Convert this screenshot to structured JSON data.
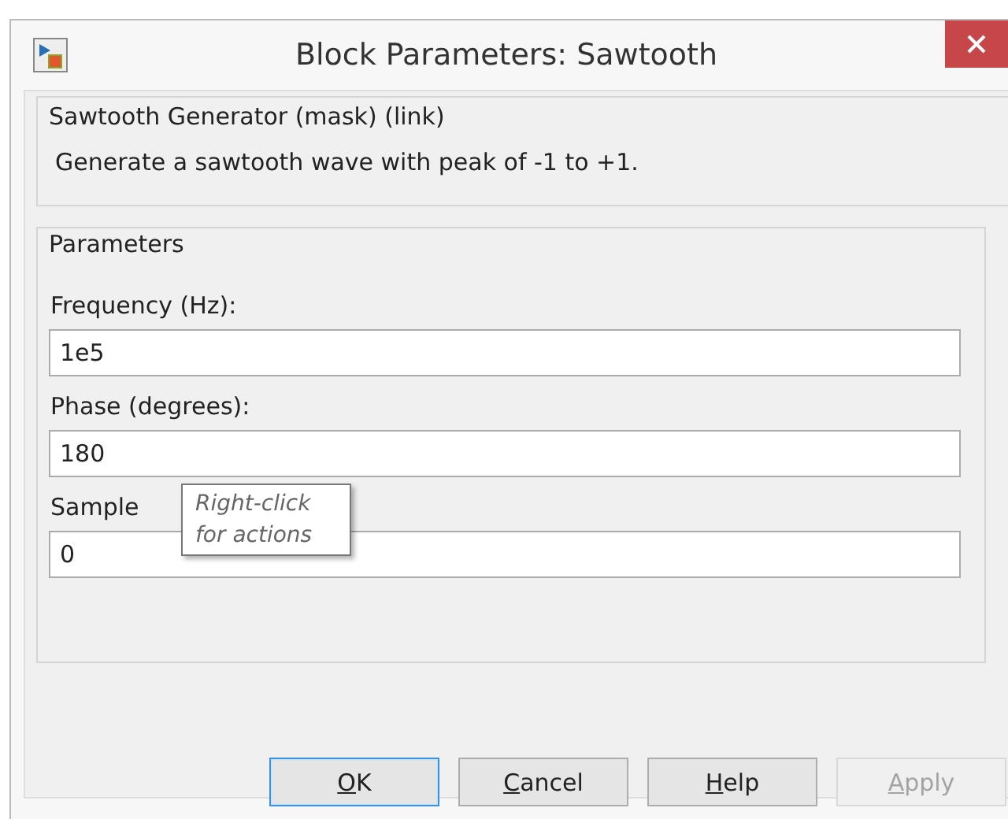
{
  "window": {
    "title": "Block Parameters: Sawtooth"
  },
  "description_group": {
    "title": "Sawtooth Generator (mask) (link)",
    "text": "Generate a sawtooth wave with peak of -1 to +1."
  },
  "parameters_group": {
    "title": "Parameters",
    "fields": [
      {
        "label": "Frequency (Hz):",
        "value": "1e5"
      },
      {
        "label": "Phase (degrees):",
        "value": "180"
      },
      {
        "label": "Sample",
        "value": "0"
      }
    ]
  },
  "tooltip": {
    "text": "Right-click for actions"
  },
  "buttons": [
    {
      "label": "OK",
      "focused": true,
      "disabled": false
    },
    {
      "label": "Cancel",
      "focused": false,
      "disabled": false
    },
    {
      "label": "Help",
      "focused": false,
      "disabled": false
    },
    {
      "label": "Apply",
      "focused": false,
      "disabled": true
    }
  ]
}
